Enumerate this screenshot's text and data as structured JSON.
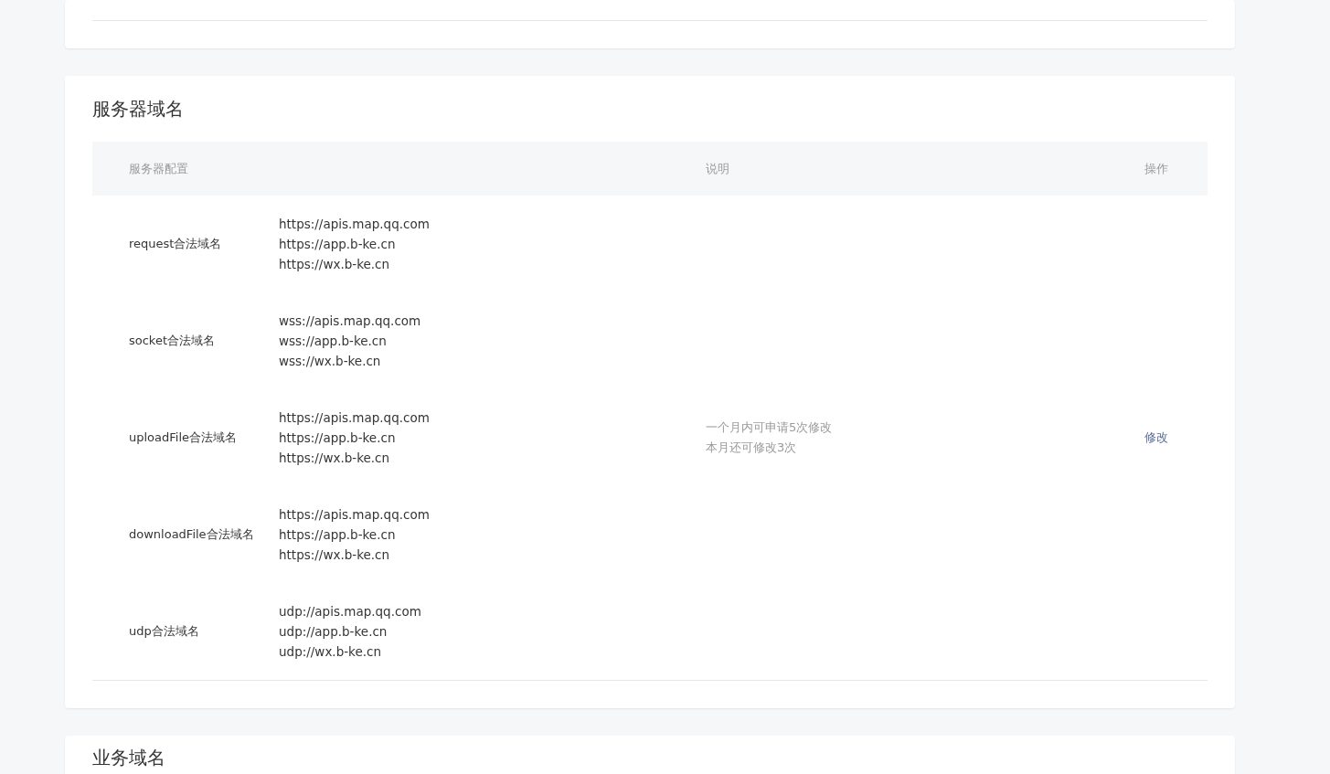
{
  "server_domain": {
    "title": "服务器域名",
    "table": {
      "columns": [
        "服务器配置",
        "说明",
        "操作"
      ],
      "rows": [
        {
          "label": "request合法域名",
          "urls": [
            "https://apis.map.qq.com",
            "https://app.b-ke.cn",
            "https://wx.b-ke.cn"
          ]
        },
        {
          "label": "socket合法域名",
          "urls": [
            "wss://apis.map.qq.com",
            "wss://app.b-ke.cn",
            "wss://wx.b-ke.cn"
          ]
        },
        {
          "label": "uploadFile合法域名",
          "urls": [
            "https://apis.map.qq.com",
            "https://app.b-ke.cn",
            "https://wx.b-ke.cn"
          ]
        },
        {
          "label": "downloadFile合法域名",
          "urls": [
            "https://apis.map.qq.com",
            "https://app.b-ke.cn",
            "https://wx.b-ke.cn"
          ]
        },
        {
          "label": "udp合法域名",
          "urls": [
            "udp://apis.map.qq.com",
            "udp://app.b-ke.cn",
            "udp://wx.b-ke.cn"
          ]
        }
      ],
      "description": [
        "一个月内可申请5次修改",
        "本月还可修改3次"
      ],
      "action": "修改"
    }
  },
  "business_domain": {
    "title": "业务域名"
  }
}
